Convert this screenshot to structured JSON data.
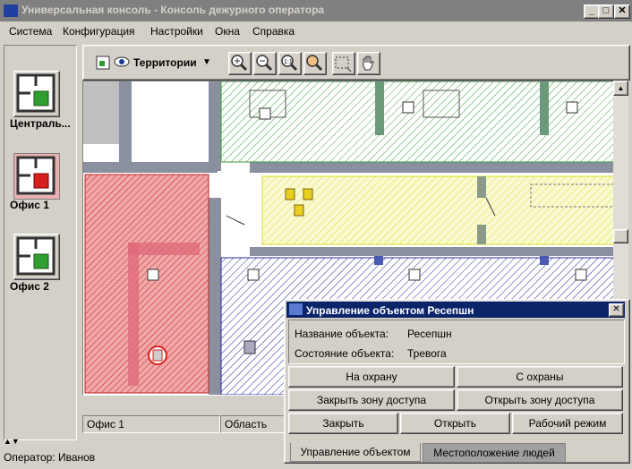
{
  "window": {
    "title": "Универсальная консоль - Консоль дежурного оператора"
  },
  "menu": {
    "items": [
      "Система",
      "Конфигурация",
      "Настройки",
      "Окна",
      "Справка"
    ]
  },
  "sites": [
    {
      "label": "Централь...",
      "state_color": "#2e9e2e"
    },
    {
      "label": "Офис 1",
      "state_color": "#d62020"
    },
    {
      "label": "Офис 2",
      "state_color": "#2e9e2e"
    }
  ],
  "toolbar": {
    "layer_dropdown": "Территории"
  },
  "map": {
    "bottom_tabs": [
      "Офис 1",
      "Область"
    ]
  },
  "status": {
    "operator": "Оператор: Иванов"
  },
  "dialog": {
    "title": "Управление объектом Ресепшн",
    "name_label": "Название объекта:",
    "name_value": "Ресепшн",
    "state_label": "Состояние объекта:",
    "state_value": "Тревога",
    "buttons": {
      "arm": "На охрану",
      "disarm": "С охраны",
      "close_zone": "Закрыть зону доступа",
      "open_zone": "Открыть зону доступа",
      "close": "Закрыть",
      "open": "Открыть",
      "work_mode": "Рабочий режим"
    },
    "tabs": [
      "Управление объектом",
      "Местоположение людей"
    ]
  },
  "colors": {
    "alarm": "#d62020",
    "ok": "#2e9e2e",
    "selected": "#f7f080",
    "dialog_title": "#0a246a"
  }
}
